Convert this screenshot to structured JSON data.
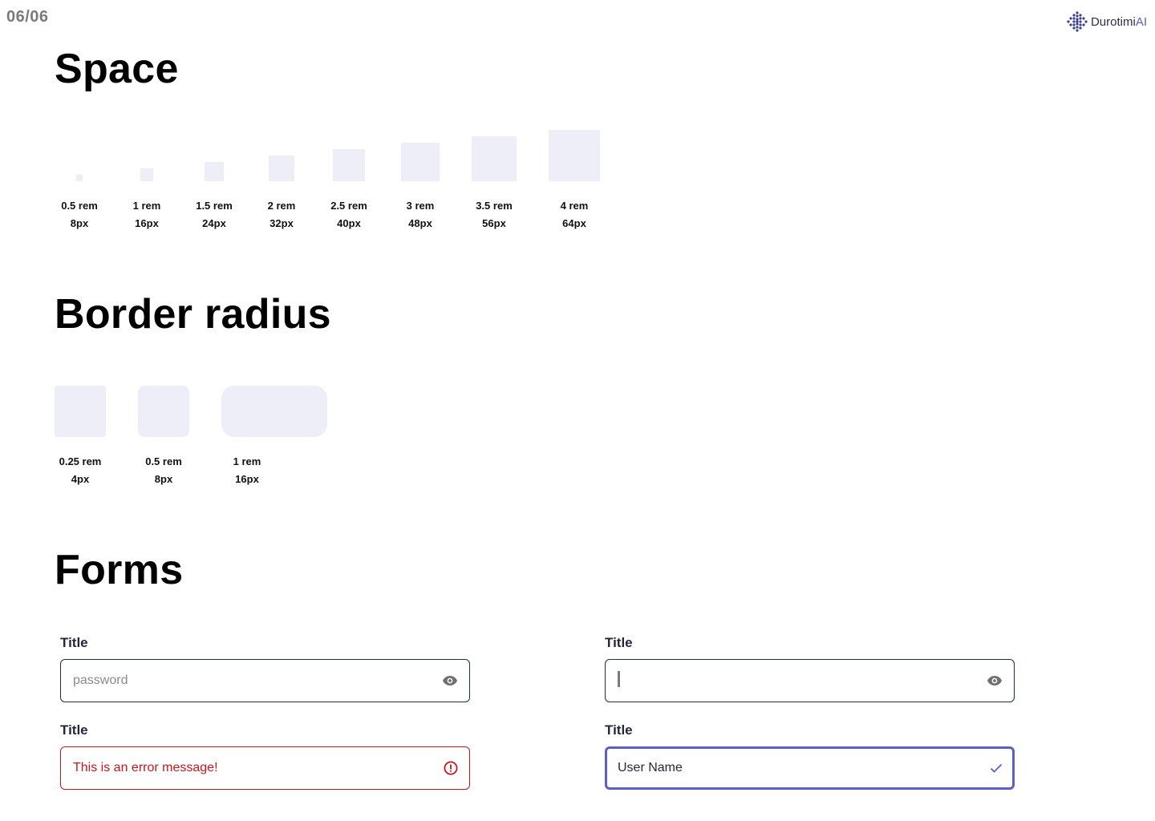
{
  "header": {
    "page_number": "06/06",
    "brand_name": "Durotimi",
    "brand_suffix": "AI"
  },
  "space": {
    "title": "Space",
    "items": [
      {
        "rem": "0.5 rem",
        "px": "8px"
      },
      {
        "rem": "1 rem",
        "px": "16px"
      },
      {
        "rem": "1.5 rem",
        "px": "24px"
      },
      {
        "rem": "2 rem",
        "px": "32px"
      },
      {
        "rem": "2.5 rem",
        "px": "40px"
      },
      {
        "rem": "3 rem",
        "px": "48px"
      },
      {
        "rem": "3.5 rem",
        "px": "56px"
      },
      {
        "rem": "4 rem",
        "px": "64px"
      }
    ]
  },
  "radius": {
    "title": "Border radius",
    "items": [
      {
        "rem": "0.25 rem",
        "px": "4px"
      },
      {
        "rem": "0.5 rem",
        "px": "8px"
      },
      {
        "rem": "1 rem",
        "px": "16px"
      }
    ]
  },
  "forms": {
    "title": "Forms",
    "fields": [
      {
        "label": "Title",
        "placeholder": "password",
        "icon": "eye-icon",
        "state": "default"
      },
      {
        "label": "Title",
        "value": "",
        "icon": "eye-icon",
        "state": "typing"
      },
      {
        "label": "Title",
        "value": "This is an error message!",
        "icon": "error-icon",
        "state": "error"
      },
      {
        "label": "Title",
        "value": "User Name",
        "icon": "check-icon",
        "state": "focused-valid"
      }
    ]
  },
  "colors": {
    "swatch": "#eeeef9",
    "error": "#c8161d",
    "focus": "#5b5fc7",
    "border": "#1f2c48"
  }
}
